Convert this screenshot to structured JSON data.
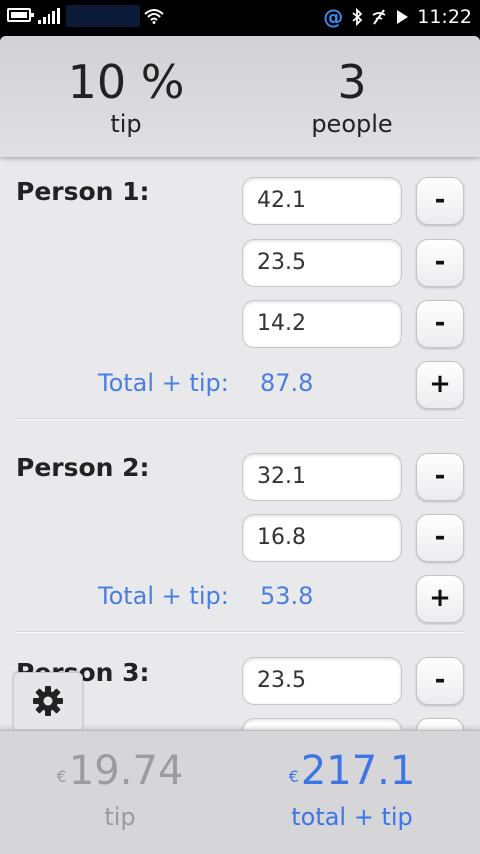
{
  "status_bar": {
    "time": "11:22",
    "at_icon": "@",
    "icons": [
      "battery-icon",
      "signal-icon",
      "wifi-icon",
      "at-icon",
      "bluetooth-icon",
      "no-signal-icon",
      "play-icon"
    ]
  },
  "header": {
    "tip_value": "10 %",
    "tip_label": "tip",
    "people_value": "3",
    "people_label": "people"
  },
  "persons": [
    {
      "label": "Person 1:",
      "amounts": [
        "42.1",
        "23.5",
        "14.2"
      ],
      "total_label": "Total + tip:",
      "total_value": "87.8"
    },
    {
      "label": "Person 2:",
      "amounts": [
        "32.1",
        "16.8"
      ],
      "total_label": "Total + tip:",
      "total_value": "53.8"
    },
    {
      "label": "Person 3:",
      "amounts": [
        "23.5",
        ""
      ]
    }
  ],
  "buttons": {
    "remove": "-",
    "add": "+"
  },
  "footer": {
    "currency": "€",
    "tip_value": "19.74",
    "tip_label": "tip",
    "total_value": "217.1",
    "total_label": "total + tip"
  },
  "colors": {
    "accent": "#3c76e6",
    "total_text": "#4a7fe0",
    "muted": "#9c9c9e",
    "background": "#e9e9ec"
  }
}
